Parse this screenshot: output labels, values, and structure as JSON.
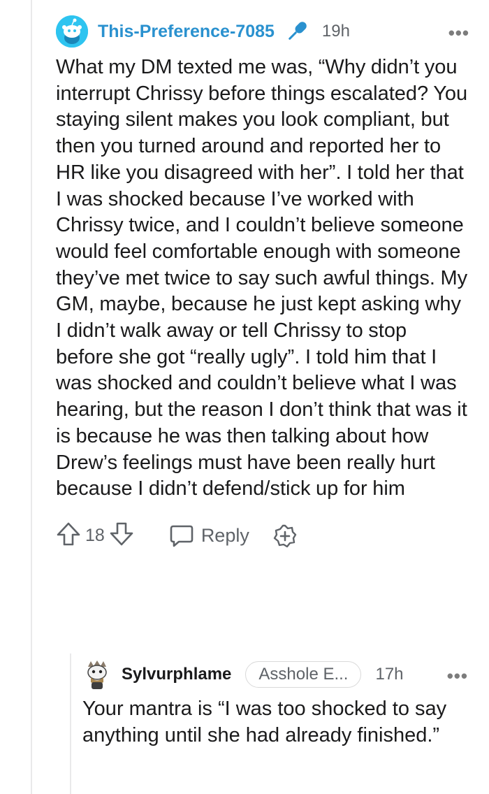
{
  "comment": {
    "username": "This-Preference-7085",
    "age": "19h",
    "more_icon": "•••",
    "body": "What my DM texted me was, “Why didn’t you interrupt Chrissy before things escalated? You staying silent makes you look compliant, but then you turned around and reported her to HR like you disagreed with her”. I told her that I was shocked because I’ve worked with Chrissy twice, and I couldn’t believe someone would feel comfortable enough with someone they’ve met twice to say such awful things. My GM, maybe, because he just kept asking why I didn’t walk away or tell Chrissy to stop before she got “really ugly”. I told him that I was shocked and couldn’t believe what I was hearing, but the reason I don’t think that was it is because he was then talking about how Drew’s feelings must have been really hurt because I didn’t defend/stick up for him",
    "vote_count": "18",
    "reply_label": "Reply",
    "icons": [
      "snoo-avatar-icon",
      "microphone-icon",
      "upvote-icon",
      "downvote-icon",
      "chat-bubble-icon",
      "award-plus-icon"
    ],
    "colors": {
      "username": "#2a91cf",
      "avatar": "#2ec4f0"
    }
  },
  "reply": {
    "username": "Sylvurphlame",
    "flair": "Asshole E...",
    "age": "17h",
    "more_icon": "•••",
    "body": "Your mantra is “I was too shocked to say anything until she had already finished.”"
  }
}
